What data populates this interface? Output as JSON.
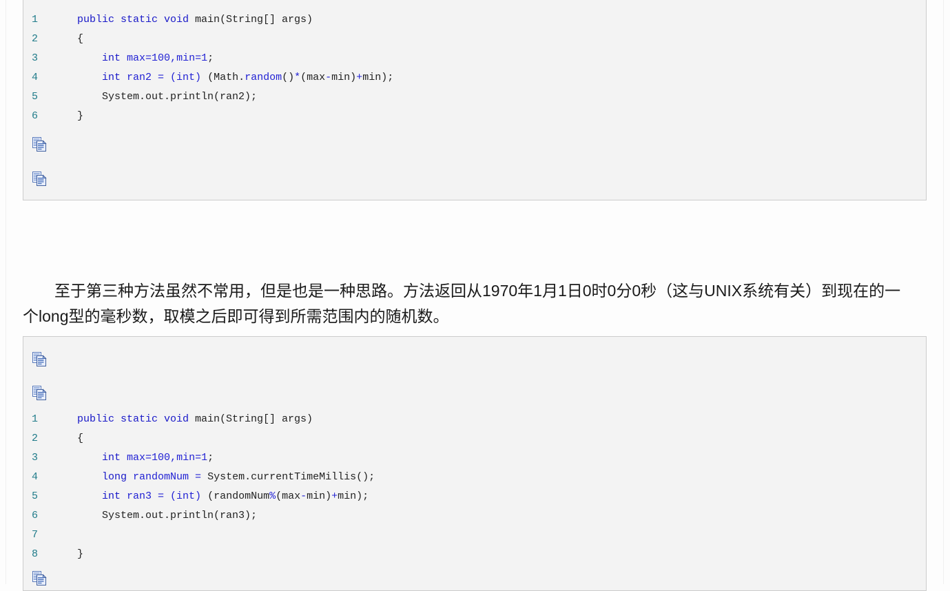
{
  "page": {
    "background_color": "#fdfdfd",
    "code_block_bg": "#f3f3f3",
    "code_block_border": "#cccccc",
    "line_number_color": "#217c8a",
    "keyword_color": "#1818c8",
    "code_text_color": "#222222"
  },
  "code_block_1": {
    "name": "java-code-sample-ran2",
    "copy_icon_label": "copy-to-clipboard",
    "lines": [
      {
        "number": "1",
        "tokens": [
          {
            "t": "public static void ",
            "c": "kw"
          },
          {
            "t": "main(String[] args)",
            "c": "pl"
          }
        ]
      },
      {
        "number": "2",
        "tokens": [
          {
            "t": "{",
            "c": "pl"
          }
        ]
      },
      {
        "number": "3",
        "tokens": [
          {
            "t": "    ",
            "c": "pl"
          },
          {
            "t": "int ",
            "c": "kw"
          },
          {
            "t": "max=",
            "c": "id"
          },
          {
            "t": "100",
            "c": "id"
          },
          {
            "t": ",min=",
            "c": "id"
          },
          {
            "t": "1",
            "c": "id"
          },
          {
            "t": ";",
            "c": "pl"
          }
        ]
      },
      {
        "number": "4",
        "tokens": [
          {
            "t": "    ",
            "c": "pl"
          },
          {
            "t": "int ",
            "c": "kw"
          },
          {
            "t": "ran2 = (int) ",
            "c": "id"
          },
          {
            "t": "(Math.",
            "c": "pl"
          },
          {
            "t": "random",
            "c": "id"
          },
          {
            "t": "()",
            "c": "pl"
          },
          {
            "t": "*",
            "c": "id"
          },
          {
            "t": "(max",
            "c": "pl"
          },
          {
            "t": "-",
            "c": "id"
          },
          {
            "t": "min)",
            "c": "pl"
          },
          {
            "t": "+",
            "c": "id"
          },
          {
            "t": "min);",
            "c": "pl"
          }
        ]
      },
      {
        "number": "5",
        "tokens": [
          {
            "t": "    System.out.println(ran2);",
            "c": "pl"
          }
        ]
      },
      {
        "number": "6",
        "tokens": [
          {
            "t": "}",
            "c": "pl"
          }
        ]
      }
    ],
    "raw_code": "public static void main(String[] args)\n{\n    int max=100,min=1;\n    int ran2 = (int) (Math.random()*(max-min)+min);\n    System.out.println(ran2);\n}"
  },
  "paragraph": {
    "line_1": "至于第三种方法虽然不常用，但是也是一种思路。方法返回从1970年1月1日0时0分0秒（这与UNIX系统有关）到现在的一个",
    "line_2": "long型的毫秒数，取模之后即可得到所需范围内的随机数。"
  },
  "code_block_2": {
    "name": "java-code-sample-ran3",
    "copy_icon_label": "copy-to-clipboard",
    "lines": [
      {
        "number": "1",
        "tokens": [
          {
            "t": "public static void ",
            "c": "kw"
          },
          {
            "t": "main(String[] args)",
            "c": "pl"
          }
        ]
      },
      {
        "number": "2",
        "tokens": [
          {
            "t": "{",
            "c": "pl"
          }
        ]
      },
      {
        "number": "3",
        "tokens": [
          {
            "t": "    ",
            "c": "pl"
          },
          {
            "t": "int ",
            "c": "kw"
          },
          {
            "t": "max=",
            "c": "id"
          },
          {
            "t": "100",
            "c": "id"
          },
          {
            "t": ",min=",
            "c": "id"
          },
          {
            "t": "1",
            "c": "id"
          },
          {
            "t": ";",
            "c": "pl"
          }
        ]
      },
      {
        "number": "4",
        "tokens": [
          {
            "t": "    ",
            "c": "pl"
          },
          {
            "t": "long ",
            "c": "kw"
          },
          {
            "t": "randomNum ",
            "c": "id"
          },
          {
            "t": "= ",
            "c": "id"
          },
          {
            "t": "System.currentTimeMillis();",
            "c": "pl"
          }
        ]
      },
      {
        "number": "5",
        "tokens": [
          {
            "t": "    ",
            "c": "pl"
          },
          {
            "t": "int ",
            "c": "kw"
          },
          {
            "t": "ran3 = (int) ",
            "c": "id"
          },
          {
            "t": "(randomNum",
            "c": "pl"
          },
          {
            "t": "%",
            "c": "id"
          },
          {
            "t": "(max",
            "c": "pl"
          },
          {
            "t": "-",
            "c": "id"
          },
          {
            "t": "min)",
            "c": "pl"
          },
          {
            "t": "+",
            "c": "id"
          },
          {
            "t": "min);",
            "c": "pl"
          }
        ]
      },
      {
        "number": "6",
        "tokens": [
          {
            "t": "    System.out.println(ran3);",
            "c": "pl"
          }
        ]
      },
      {
        "number": "7",
        "tokens": [
          {
            "t": "",
            "c": "pl"
          }
        ]
      },
      {
        "number": "8",
        "tokens": [
          {
            "t": "}",
            "c": "pl"
          }
        ]
      }
    ],
    "raw_code": "public static void main(String[] args)\n{\n    int max=100,min=1;\n    long randomNum = System.currentTimeMillis();\n    int ran3 = (int) (randomNum%(max-min)+min);\n    System.out.println(ran3);\n\n}"
  }
}
